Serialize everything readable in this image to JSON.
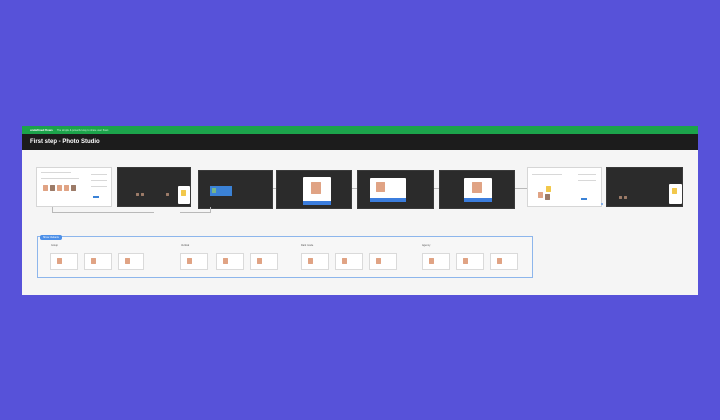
{
  "header": {
    "brand": "undefined flows",
    "brand_sub": "The simple & powerful way to share user flows",
    "title": "First step - Photo Studio"
  },
  "variants_section": {
    "chip_label": "Show Variants",
    "groups": [
      "Group",
      "Vertical",
      "Dark mode",
      "Agency"
    ]
  },
  "colors": {
    "background": "#5752d9",
    "topbar": "#1ca34b",
    "titlebar": "#1c1c1c",
    "accent": "#3b7ddd"
  }
}
